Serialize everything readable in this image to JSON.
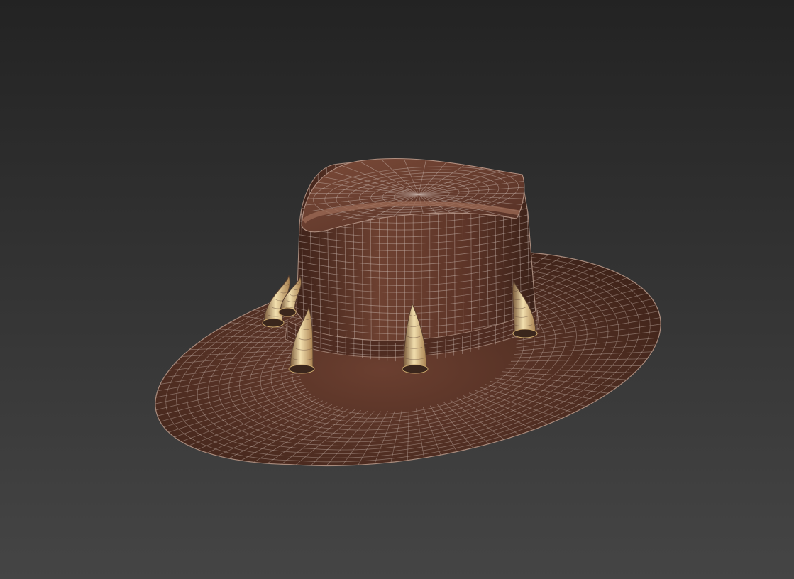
{
  "scene": {
    "subject": "hat-model",
    "render_mode": "wireframe-on-shaded",
    "colors": {
      "background_top": "#232323",
      "background_bottom": "#454545",
      "leather_dark": "#4a2a20",
      "leather_mid": "#6b3f30",
      "leather_light": "#8a5641",
      "wire": "#c9b8b0",
      "tooth_light": "#f2dfae",
      "tooth_mid": "#c9a66b",
      "tooth_dark": "#5a4030",
      "tooth_ring": "#3a261c"
    },
    "tooth_count": 5
  }
}
